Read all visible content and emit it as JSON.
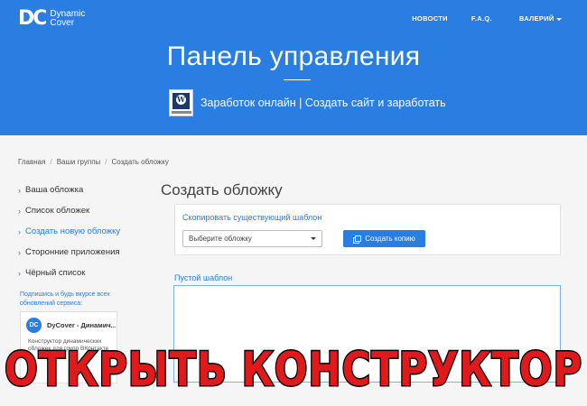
{
  "header": {
    "logo_mark": "DC",
    "logo_line1": "Dynamic",
    "logo_line2": "Cover",
    "nav": {
      "news": "НОВОСТИ",
      "faq": "F.A.Q.",
      "user": "ВАЛЕРИЙ"
    },
    "title": "Панель управления",
    "subtitle": "Заработок онлайн | Создать сайт и заработать",
    "thumb_letter": "W"
  },
  "breadcrumb": [
    "Главная",
    "Ваши группы",
    "Создать обложку"
  ],
  "sidebar": {
    "items": [
      {
        "label": "Ваша обложка",
        "active": false
      },
      {
        "label": "Список обложек",
        "active": false
      },
      {
        "label": "Создать новую обложку",
        "active": true
      },
      {
        "label": "Сторонние приложения",
        "active": false
      },
      {
        "label": "Чёрный список",
        "active": false
      }
    ],
    "promo": "Подпишись и будь вкурсе всех обновлений сервиса:",
    "card": {
      "avatar": "DC",
      "name": "DyCover - Динамич...",
      "desc": "Конструктор динамических обложек для групп ВКонтакте"
    }
  },
  "main": {
    "title": "Создать обложку",
    "copy_label": "Скопировать существующий шаблон",
    "select_value": "Выберите обложку",
    "copy_button": "Создать копию",
    "empty_label": "Пустой шаблон"
  },
  "overlay_banner": "ОТКРЫТЬ КОНСТРУКТОР",
  "colors": {
    "primary": "#2a7de1",
    "banner": "#e0191b"
  }
}
